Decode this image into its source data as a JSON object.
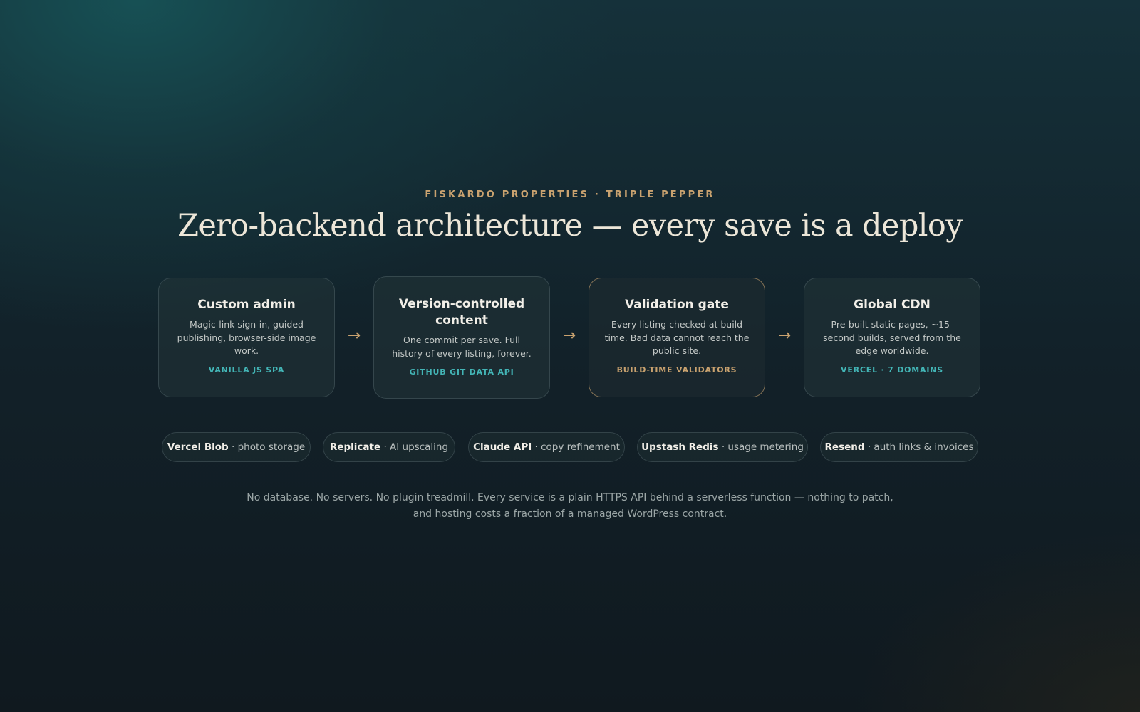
{
  "eyebrow": "FISKARDO PROPERTIES · TRIPLE PEPPER",
  "headline": "Zero-backend architecture — every save is a deploy",
  "flow": {
    "arrow_glyph": "→",
    "steps": [
      {
        "title": "Custom admin",
        "description": "Magic-link sign-in, guided publishing, browser-side image work.",
        "tag": "VANILLA JS SPA",
        "tag_color": "#43b5b6"
      },
      {
        "title": "Version-controlled content",
        "description": "One commit per save. Full history of every listing, forever.",
        "tag": "GITHUB GIT DATA API",
        "tag_color": "#43b5b6"
      },
      {
        "title": "Validation gate",
        "description": "Every listing checked at build time. Bad data cannot reach the public site.",
        "tag": "BUILD-TIME VALIDATORS",
        "tag_color": "#c9a26f",
        "highlighted": true
      },
      {
        "title": "Global CDN",
        "description": "Pre-built static pages, ~15-second builds, served from the edge worldwide.",
        "tag": "VERCEL · 7 DOMAINS",
        "tag_color": "#43b5b6"
      }
    ]
  },
  "services": [
    {
      "name": "Vercel Blob",
      "separator": " · ",
      "purpose": "photo storage"
    },
    {
      "name": "Replicate",
      "separator": " · ",
      "purpose": "AI upscaling"
    },
    {
      "name": "Claude API",
      "separator": " · ",
      "purpose": "copy refinement"
    },
    {
      "name": "Upstash Redis",
      "separator": " · ",
      "purpose": "usage metering"
    },
    {
      "name": "Resend",
      "separator": " · ",
      "purpose": "auth links & invoices"
    }
  ],
  "footnote": {
    "line1": "No database. No servers. No plugin treadmill. Every service is a plain HTTPS API behind a serverless function — nothing to patch,",
    "line2": "and hosting costs a fraction of a managed WordPress contract."
  },
  "colors": {
    "accent_gold": "#c9a26f",
    "accent_teal": "#43b5b6",
    "background_top": "#15313a",
    "background_bottom": "#10191f"
  }
}
